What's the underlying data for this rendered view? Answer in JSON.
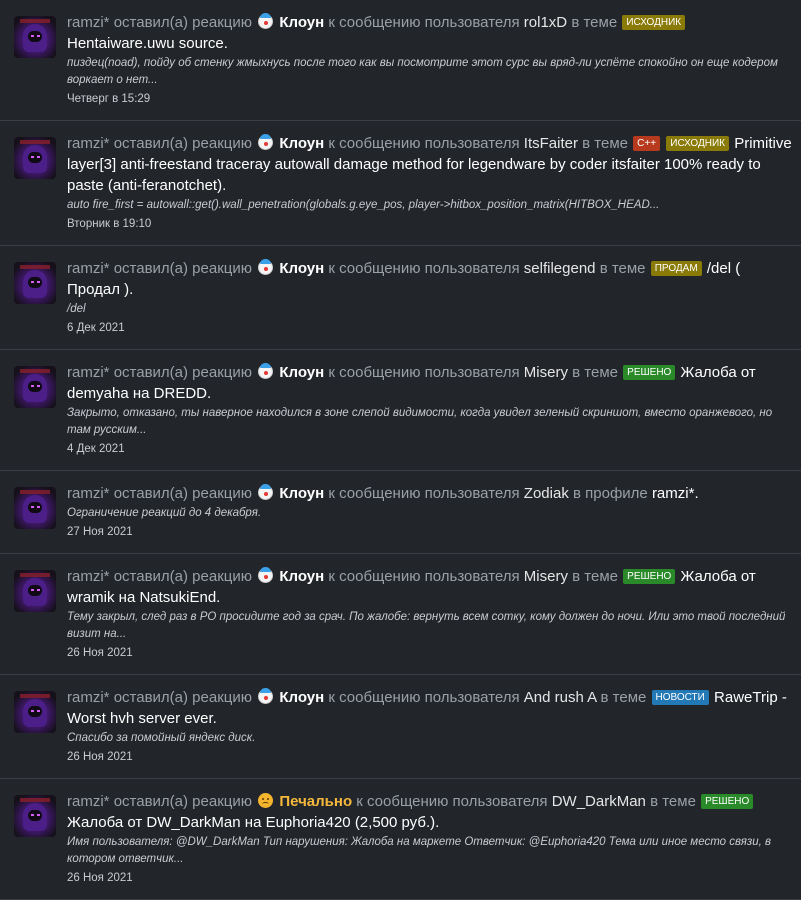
{
  "items": [
    {
      "user": "ramzi*",
      "action": "оставил(а) реакцию",
      "emoji": "clown",
      "reaction": "Клоун",
      "mid": "к сообщению пользователя",
      "poster": "rol1xD",
      "where": "в теме",
      "badges": [
        {
          "text": "Исходник",
          "kind": "src"
        }
      ],
      "title": "Hentaiware.uwu source.",
      "snippet": "пиздец(noad), пойду об стенку жмыхнусь после того как вы посмотрите этот сурс вы вряд-ли успёте спокойно он еще кодером воркает о нет...",
      "time": "Четверг в 15:29"
    },
    {
      "user": "ramzi*",
      "action": "оставил(а) реакцию",
      "emoji": "clown",
      "reaction": "Клоун",
      "mid": "к сообщению пользователя",
      "poster": "ItsFaiter",
      "where": "в теме",
      "badges": [
        {
          "text": "C++",
          "kind": "cpp"
        },
        {
          "text": "Исходник",
          "kind": "src"
        }
      ],
      "title": "Primitive layer[3] anti-freestand traceray autowall damage method for legendware by coder itsfaiter 100% ready to paste (anti-feranotchet).",
      "snippet": "auto fire_first = autowall::get().wall_penetration(globals.g.eye_pos, player->hitbox_position_matrix(HITBOX_HEAD...",
      "time": "Вторник в 19:10"
    },
    {
      "user": "ramzi*",
      "action": "оставил(а) реакцию",
      "emoji": "clown",
      "reaction": "Клоун",
      "mid": "к сообщению пользователя",
      "poster": "selfilegend",
      "where": "в теме",
      "badges": [
        {
          "text": "Продам",
          "kind": "sell"
        }
      ],
      "title": "/del ( Продал ).",
      "snippet": "/del",
      "time": "6 Дек 2021"
    },
    {
      "user": "ramzi*",
      "action": "оставил(а) реакцию",
      "emoji": "clown",
      "reaction": "Клоун",
      "mid": "к сообщению пользователя",
      "poster": "Misery",
      "where": "в теме",
      "badges": [
        {
          "text": "Решено",
          "kind": "solved"
        }
      ],
      "title": "Жалоба от demyaha на DREDD.",
      "snippet": "Закрыто, отказано, ты наверное находился в зоне слепой видимости, когда увидел зеленый скриншот, вместо оранжевого, но там русским...",
      "time": "4 Дек 2021"
    },
    {
      "user": "ramzi*",
      "action": "оставил(а) реакцию",
      "emoji": "clown",
      "reaction": "Клоун",
      "mid": "к сообщению пользователя",
      "poster": "Zodiak",
      "where": "в профиле",
      "badges": [],
      "title": "ramzi*.",
      "snippet": "Ограничение реакций до 4 декабря.",
      "time": "27 Ноя 2021"
    },
    {
      "user": "ramzi*",
      "action": "оставил(а) реакцию",
      "emoji": "clown",
      "reaction": "Клоун",
      "mid": "к сообщению пользователя",
      "poster": "Misery",
      "where": "в теме",
      "badges": [
        {
          "text": "Решено",
          "kind": "solved"
        }
      ],
      "title": "Жалоба от wramik на NatsukiEnd.",
      "snippet": "Тему закрыл, след раз в РО просидите год за срач. По жалобе: вернуть всем сотку, кому должен до ночи. Или это твой последний визит на...",
      "time": "26 Ноя 2021"
    },
    {
      "user": "ramzi*",
      "action": "оставил(а) реакцию",
      "emoji": "clown",
      "reaction": "Клоун",
      "mid": "к сообщению пользователя",
      "poster": "And rush A",
      "where": "в теме",
      "badges": [
        {
          "text": "Новости",
          "kind": "news"
        }
      ],
      "title": "RaweTrip - Worst hvh server ever.",
      "snippet": "Спасибо за помойный яндекс диск.",
      "time": "26 Ноя 2021"
    },
    {
      "user": "ramzi*",
      "action": "оставил(а) реакцию",
      "emoji": "sad",
      "reaction": "Печально",
      "mid": "к сообщению пользователя",
      "poster": "DW_DarkMan",
      "where": "в теме",
      "badges": [
        {
          "text": "Решено",
          "kind": "solved"
        }
      ],
      "title": "Жалоба от DW_DarkMan на Euphoria420 (2,500 руб.).",
      "snippet": "Имя пользователя: @DW_DarkMan Тип нарушения: Жалоба на маркете Ответчик: @Euphoria420 Тема или иное место связи, в котором ответчик...",
      "time": "26 Ноя 2021"
    }
  ]
}
